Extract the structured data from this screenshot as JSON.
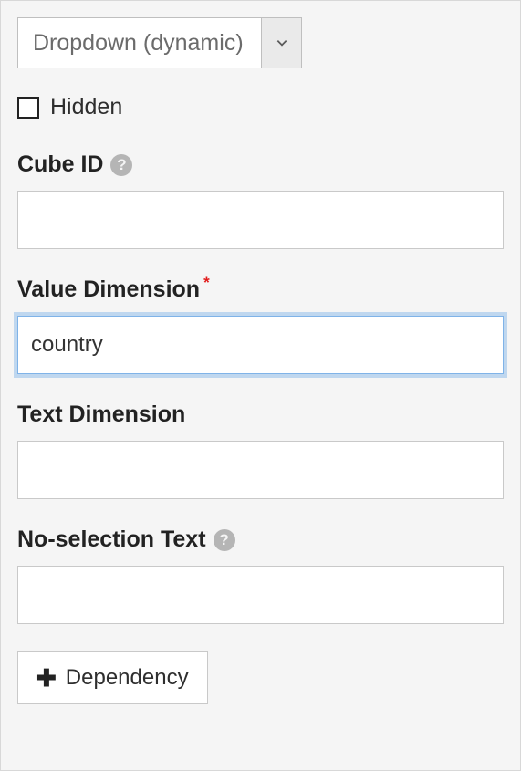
{
  "type_select": {
    "value": "Dropdown (dynamic)"
  },
  "hidden": {
    "label": "Hidden"
  },
  "cube_id": {
    "label": "Cube ID",
    "value": ""
  },
  "value_dimension": {
    "label": "Value Dimension",
    "value": "country"
  },
  "text_dimension": {
    "label": "Text Dimension",
    "value": ""
  },
  "no_selection_text": {
    "label": "No-selection Text",
    "value": ""
  },
  "dependency_button": {
    "label": "Dependency"
  }
}
